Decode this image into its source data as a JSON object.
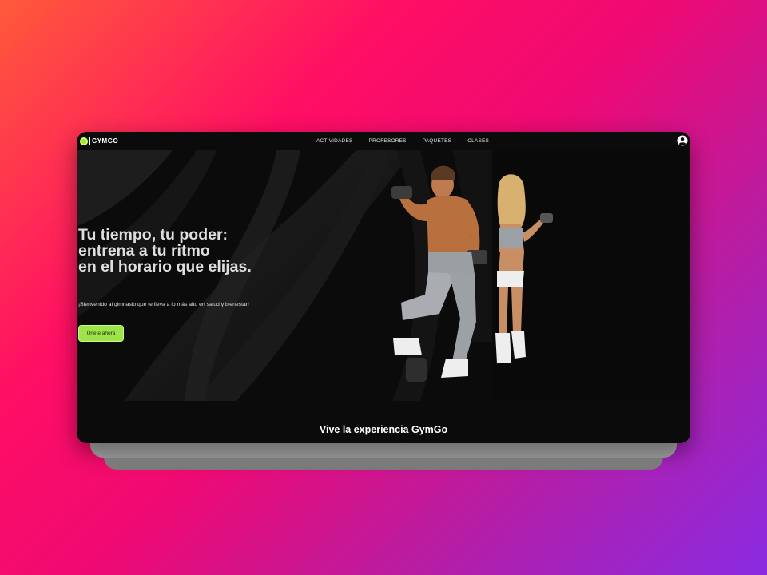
{
  "brand": {
    "name": "GYMGO",
    "accent": "#9ee34a"
  },
  "nav": {
    "items": [
      "ACTIVIDADES",
      "PROFESORES",
      "PAQUETES",
      "CLASES"
    ],
    "user_icon": "user-circle-icon"
  },
  "hero": {
    "headline": [
      "Tu tiempo, tu poder:",
      "entrena a tu ritmo",
      "en el horario que elijas."
    ],
    "subtitle": "¡Bienvenido al gimnasio que te lleva a lo más alto en salud y bienestar!",
    "cta_label": "Únete ahora"
  },
  "experience": {
    "title": "Vive la experiencia GymGo"
  }
}
